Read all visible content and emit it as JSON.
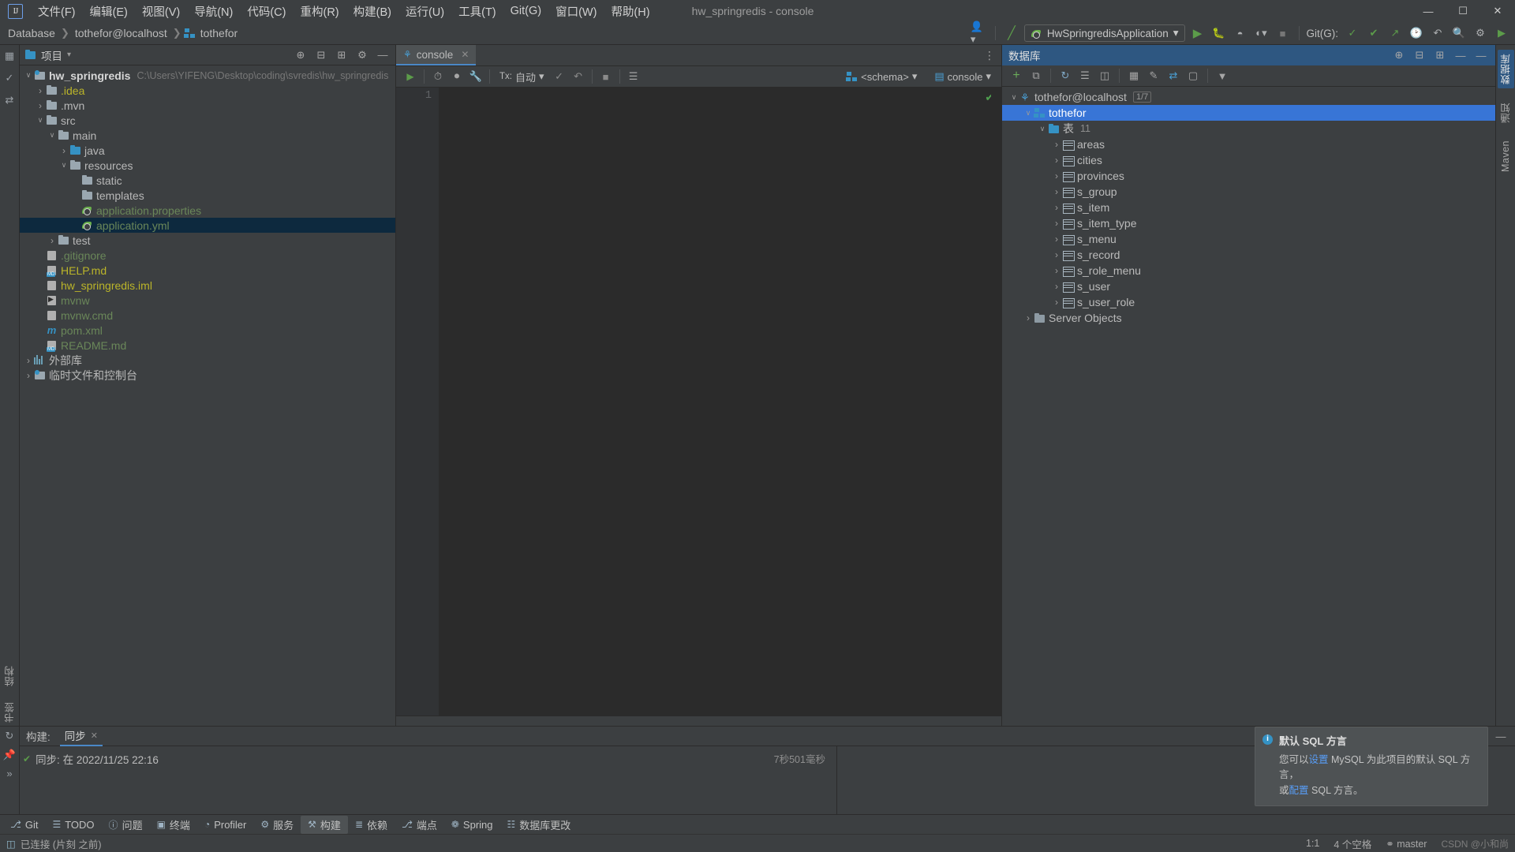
{
  "window": {
    "title": "hw_springredis - console",
    "logo": "IJ",
    "controls": {
      "minimize": "—",
      "maximize": "☐",
      "close": "✕"
    }
  },
  "menubar": [
    {
      "label": "文件(F)"
    },
    {
      "label": "编辑(E)"
    },
    {
      "label": "视图(V)"
    },
    {
      "label": "导航(N)"
    },
    {
      "label": "代码(C)"
    },
    {
      "label": "重构(R)"
    },
    {
      "label": "构建(B)"
    },
    {
      "label": "运行(U)"
    },
    {
      "label": "工具(T)"
    },
    {
      "label": "Git(G)"
    },
    {
      "label": "窗口(W)"
    },
    {
      "label": "帮助(H)"
    }
  ],
  "navbar": {
    "breadcrumbs": [
      "Database",
      "tothefor@localhost",
      "tothefor"
    ],
    "run_config": "HwSpringredisApplication",
    "git_label": "Git(G):",
    "icons": [
      "user-icon",
      "build-hammer-icon",
      "run-icon",
      "debug-icon",
      "run-coverage-icon",
      "profiler-icon",
      "stop-icon",
      "git-update-icon",
      "git-commit-icon",
      "git-push-icon",
      "git-history-icon",
      "undo-icon",
      "search-icon",
      "settings-icon"
    ]
  },
  "left_strip": {
    "top_icons": [
      "project-icon",
      "commit-icon",
      "pull-request-icon"
    ],
    "bottom_tabs": [
      "结构",
      "书签"
    ]
  },
  "right_strip": {
    "tabs": [
      "数据库",
      "通知",
      "Maven"
    ]
  },
  "project_panel": {
    "title": "项目",
    "header_icons": [
      "locate-icon",
      "collapse-all-icon",
      "expand-icon",
      "settings-icon",
      "hide-icon"
    ],
    "tree": [
      {
        "depth": 0,
        "arrow": "down",
        "icon": "module-folder",
        "label": "hw_springredis",
        "bold": true,
        "path": "C:\\Users\\YIFENG\\Desktop\\coding\\svredis\\hw_springredis"
      },
      {
        "depth": 1,
        "arrow": "right",
        "icon": "folder",
        "label": ".idea",
        "color": "olive"
      },
      {
        "depth": 1,
        "arrow": "right",
        "icon": "folder",
        "label": ".mvn",
        "color": "grey"
      },
      {
        "depth": 1,
        "arrow": "down",
        "icon": "folder",
        "label": "src",
        "color": "grey"
      },
      {
        "depth": 2,
        "arrow": "down",
        "icon": "folder",
        "label": "main",
        "color": "grey"
      },
      {
        "depth": 3,
        "arrow": "right",
        "icon": "folder-blue",
        "label": "java",
        "color": "grey"
      },
      {
        "depth": 3,
        "arrow": "down",
        "icon": "folder-res",
        "label": "resources",
        "color": "grey"
      },
      {
        "depth": 4,
        "arrow": "none",
        "icon": "folder",
        "label": "static",
        "color": "grey"
      },
      {
        "depth": 4,
        "arrow": "none",
        "icon": "folder",
        "label": "templates",
        "color": "grey"
      },
      {
        "depth": 4,
        "arrow": "none",
        "icon": "spring-file",
        "label": "application.properties",
        "color": "green"
      },
      {
        "depth": 4,
        "arrow": "none",
        "icon": "spring-file",
        "label": "application.yml",
        "color": "green",
        "selected": true
      },
      {
        "depth": 2,
        "arrow": "right",
        "icon": "folder",
        "label": "test",
        "color": "grey"
      },
      {
        "depth": 1,
        "arrow": "none",
        "icon": "gitignore-file",
        "label": ".gitignore",
        "color": "green"
      },
      {
        "depth": 1,
        "arrow": "none",
        "icon": "md-file",
        "label": "HELP.md",
        "color": "olive"
      },
      {
        "depth": 1,
        "arrow": "none",
        "icon": "iml-file",
        "label": "hw_springredis.iml",
        "color": "olive"
      },
      {
        "depth": 1,
        "arrow": "none",
        "icon": "sh-file",
        "label": "mvnw",
        "color": "green"
      },
      {
        "depth": 1,
        "arrow": "none",
        "icon": "cmd-file",
        "label": "mvnw.cmd",
        "color": "green"
      },
      {
        "depth": 1,
        "arrow": "none",
        "icon": "maven-file",
        "label": "pom.xml",
        "color": "green"
      },
      {
        "depth": 1,
        "arrow": "none",
        "icon": "md-file",
        "label": "README.md",
        "color": "green"
      },
      {
        "depth": 0,
        "arrow": "right",
        "icon": "library-icon",
        "label": "外部库",
        "color": "grey"
      },
      {
        "depth": 0,
        "arrow": "right",
        "icon": "scratch-icon",
        "label": "临时文件和控制台",
        "color": "grey"
      }
    ]
  },
  "editor": {
    "tab": {
      "label": "console",
      "icon": "console-icon",
      "close": "✕"
    },
    "toolbar": {
      "run_icon": "execute-icon",
      "icons": [
        "history-icon",
        "stop-icon",
        "settings-wrench-icon",
        "commit-icon",
        "rollback-icon",
        "cancel-icon",
        "table-icon"
      ],
      "tx_label": "Tx:",
      "tx_value": "自动",
      "schema_value": "<schema>",
      "console_value": "console"
    },
    "gutter_lines": [
      "1"
    ],
    "content": "",
    "ok_mark": "✔"
  },
  "database_panel": {
    "title": "数据库",
    "header_icons": [
      "settings-icon",
      "collapse-all-icon",
      "expand-icon",
      "minimize-icon",
      "hide-icon"
    ],
    "toolbar_icons": [
      "add-icon",
      "duplicate-icon",
      "refresh-icon",
      "run-sql-icon",
      "datasource-icon",
      "table-editor-icon",
      "modify-icon",
      "sync-icon",
      "filter-icon",
      "search-filter-icon"
    ],
    "tree": [
      {
        "depth": 0,
        "arrow": "down",
        "icon": "mysql-icon",
        "label": "tothefor@localhost",
        "badge": "1/7"
      },
      {
        "depth": 1,
        "arrow": "down",
        "icon": "schema-icon",
        "label": "tothefor",
        "selected": true
      },
      {
        "depth": 2,
        "arrow": "down",
        "icon": "db-folder",
        "label": "表",
        "count": "11"
      },
      {
        "depth": 3,
        "arrow": "right",
        "icon": "table-icon",
        "label": "areas"
      },
      {
        "depth": 3,
        "arrow": "right",
        "icon": "table-icon",
        "label": "cities"
      },
      {
        "depth": 3,
        "arrow": "right",
        "icon": "table-icon",
        "label": "provinces"
      },
      {
        "depth": 3,
        "arrow": "right",
        "icon": "table-icon",
        "label": "s_group"
      },
      {
        "depth": 3,
        "arrow": "right",
        "icon": "table-icon",
        "label": "s_item"
      },
      {
        "depth": 3,
        "arrow": "right",
        "icon": "table-icon",
        "label": "s_item_type"
      },
      {
        "depth": 3,
        "arrow": "right",
        "icon": "table-icon",
        "label": "s_menu"
      },
      {
        "depth": 3,
        "arrow": "right",
        "icon": "table-icon",
        "label": "s_record"
      },
      {
        "depth": 3,
        "arrow": "right",
        "icon": "table-icon",
        "label": "s_role_menu"
      },
      {
        "depth": 3,
        "arrow": "right",
        "icon": "table-icon",
        "label": "s_user"
      },
      {
        "depth": 3,
        "arrow": "right",
        "icon": "table-icon",
        "label": "s_user_role"
      },
      {
        "depth": 1,
        "arrow": "right",
        "icon": "server-objects-icon",
        "label": "Server Objects"
      }
    ]
  },
  "build_panel": {
    "label": "构建:",
    "tab": {
      "label": "同步",
      "close": "✕"
    },
    "sync_status": "同步: 在 2022/11/25 22:16",
    "sync_duration": "7秒501毫秒",
    "check_icon": "✔",
    "side_icons": [
      "rerun-icon",
      "pin-icon",
      "expand-icon"
    ]
  },
  "notification": {
    "title": "默认 SQL 方言",
    "line1_pre": "您可以",
    "line1_link": "设置",
    "line1_mid": " MySQL ",
    "line1_post": "为此项目的默认 SQL 方言，",
    "line2_pre": "或",
    "line2_link": "配置",
    "line2_post": " SQL 方言。",
    "info_glyph": "i"
  },
  "tool_buttons": [
    {
      "icon": "git-icon",
      "label": "Git"
    },
    {
      "icon": "todo-icon",
      "label": "TODO"
    },
    {
      "icon": "problems-icon",
      "label": "问题"
    },
    {
      "icon": "terminal-icon",
      "label": "终端"
    },
    {
      "icon": "profiler-icon",
      "label": "Profiler"
    },
    {
      "icon": "services-icon",
      "label": "服务"
    },
    {
      "icon": "build-icon",
      "label": "构建",
      "active": true
    },
    {
      "icon": "dependencies-icon",
      "label": "依赖"
    },
    {
      "icon": "endpoints-icon",
      "label": "端点"
    },
    {
      "icon": "spring-icon",
      "label": "Spring"
    },
    {
      "icon": "db-changes-icon",
      "label": "数据库更改"
    }
  ],
  "statusbar": {
    "left_icon": "connection-icon",
    "left_text": "已连接 (片刻 之前)",
    "caret": "1:1",
    "indent": "4 个空格",
    "branch_icon": "branch-icon",
    "branch": "master",
    "watermark": "CSDN @小和尚"
  },
  "colors": {
    "accent_blue": "#3875d6",
    "selection_dark": "#0d293e",
    "panel_bg": "#3c3f41",
    "editor_bg": "#2b2b2b",
    "header_blue": "#2e5781",
    "green": "#6a8759",
    "olive": "#bbb529",
    "link": "#589df6"
  }
}
